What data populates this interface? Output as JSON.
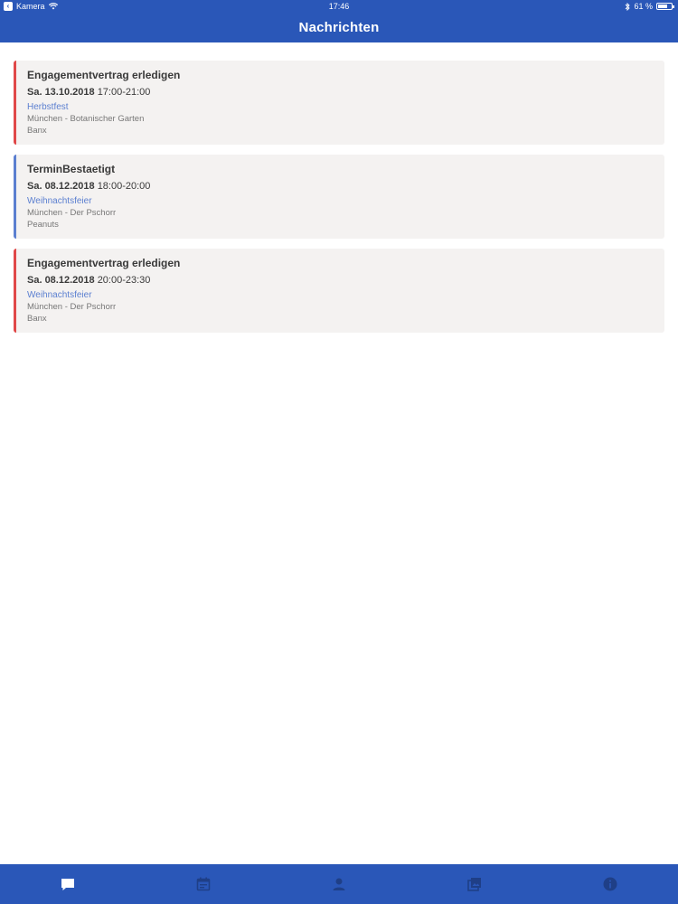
{
  "status_bar": {
    "carrier": "Kamera",
    "time": "17:46",
    "battery_percent": "61 %",
    "battery_level": 0.61
  },
  "nav": {
    "title": "Nachrichten"
  },
  "messages": [
    {
      "title": "Engagementvertrag erledigen",
      "date": "Sa. 13.10.2018",
      "time": "17:00-21:00",
      "event": "Herbstfest",
      "location": "München - Botanischer Garten",
      "act": "Banx",
      "status": "open",
      "accent_color": "#e04848"
    },
    {
      "title": "TerminBestaetigt",
      "date": "Sa. 08.12.2018",
      "time": "18:00-20:00",
      "event": "Weihnachtsfeier",
      "location": "München - Der Pschorr",
      "act": "Peanuts",
      "status": "confirmed",
      "accent_color": "#5b7fd0"
    },
    {
      "title": "Engagementvertrag erledigen",
      "date": "Sa. 08.12.2018",
      "time": "20:00-23:30",
      "event": "Weihnachtsfeier",
      "location": "München - Der Pschorr",
      "act": "Banx",
      "status": "open",
      "accent_color": "#e04848"
    }
  ],
  "tabs": [
    {
      "icon": "message-icon",
      "active": true
    },
    {
      "icon": "calendar-icon",
      "active": false
    },
    {
      "icon": "person-icon",
      "active": false
    },
    {
      "icon": "gallery-icon",
      "active": false
    },
    {
      "icon": "info-icon",
      "active": false
    }
  ],
  "colors": {
    "brand": "#2a57b8",
    "card_background": "#f4f2f1",
    "event_link": "#5b7fd0",
    "open_accent": "#e04848"
  }
}
